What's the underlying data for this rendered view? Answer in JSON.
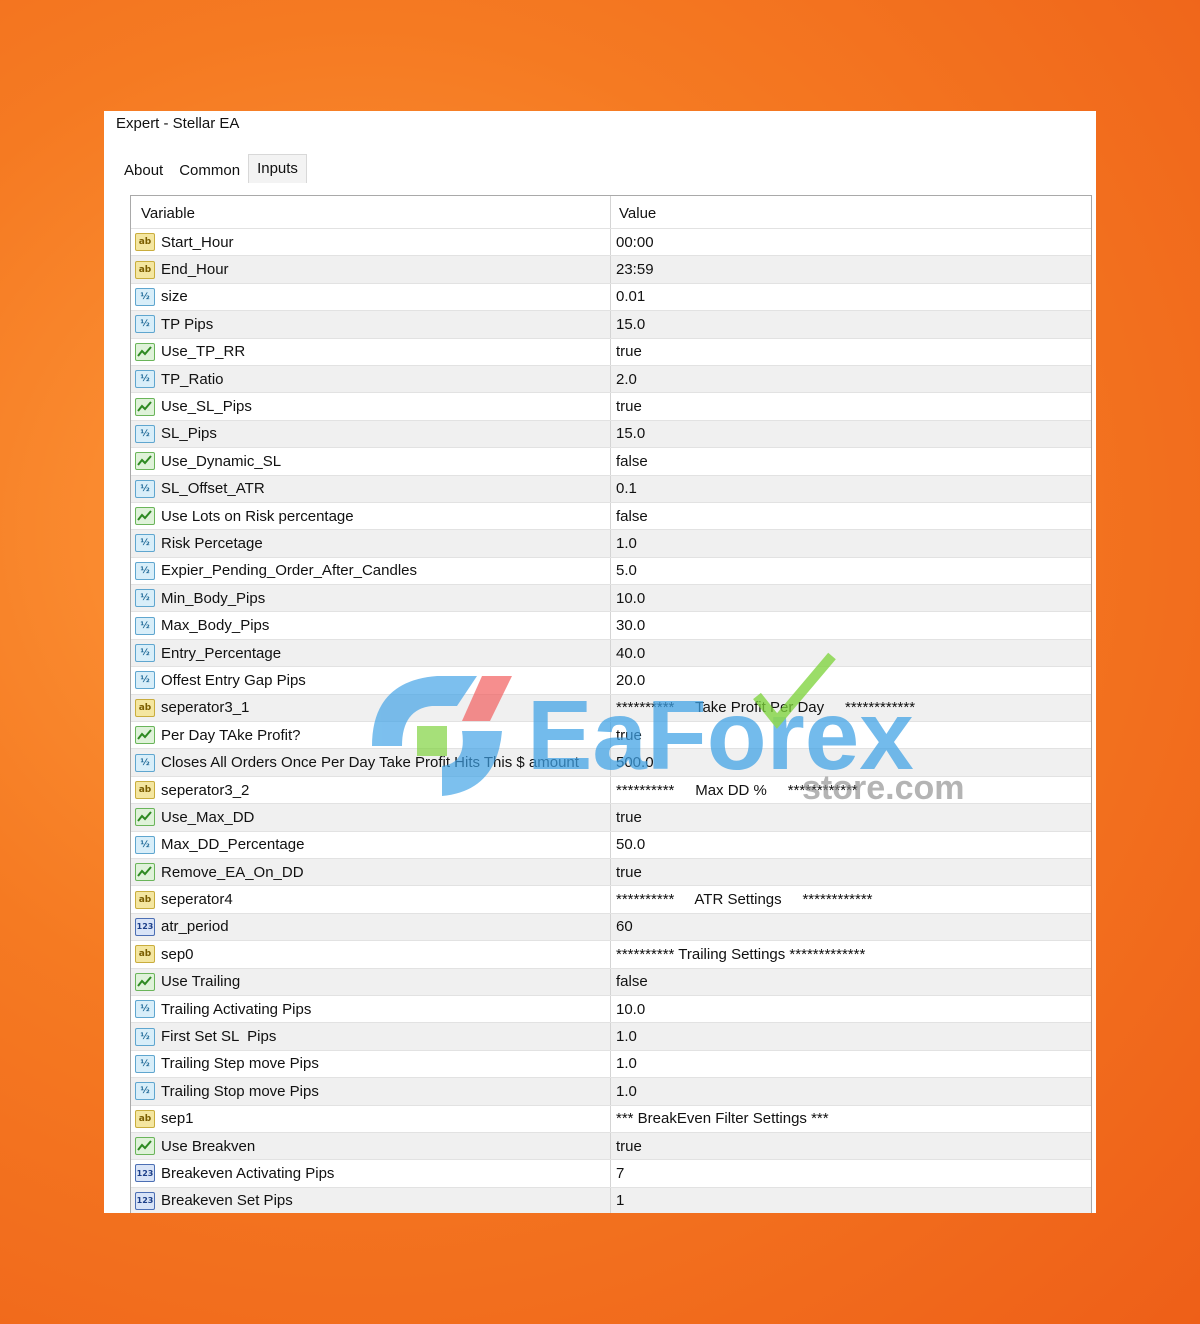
{
  "window": {
    "title": "Expert - Stellar EA"
  },
  "tabs": [
    {
      "label": "About",
      "active": false
    },
    {
      "label": "Common",
      "active": false
    },
    {
      "label": "Inputs",
      "active": true
    }
  ],
  "table": {
    "headers": {
      "variable": "Variable",
      "value": "Value"
    },
    "rows": [
      {
        "type": "string",
        "name": "Start_Hour",
        "value": "00:00"
      },
      {
        "type": "string",
        "name": "End_Hour",
        "value": "23:59"
      },
      {
        "type": "double",
        "name": "size",
        "value": "0.01"
      },
      {
        "type": "double",
        "name": "TP Pips",
        "value": "15.0"
      },
      {
        "type": "bool",
        "name": "Use_TP_RR",
        "value": "true"
      },
      {
        "type": "double",
        "name": "TP_Ratio",
        "value": "2.0"
      },
      {
        "type": "bool",
        "name": "Use_SL_Pips",
        "value": "true"
      },
      {
        "type": "double",
        "name": "SL_Pips",
        "value": "15.0"
      },
      {
        "type": "bool",
        "name": "Use_Dynamic_SL",
        "value": "false"
      },
      {
        "type": "double",
        "name": "SL_Offset_ATR",
        "value": "0.1"
      },
      {
        "type": "bool",
        "name": "Use Lots on Risk percentage",
        "value": "false"
      },
      {
        "type": "double",
        "name": "Risk Percetage",
        "value": "1.0"
      },
      {
        "type": "double",
        "name": "Expier_Pending_Order_After_Candles",
        "value": "5.0"
      },
      {
        "type": "double",
        "name": "Min_Body_Pips",
        "value": "10.0"
      },
      {
        "type": "double",
        "name": "Max_Body_Pips",
        "value": "30.0"
      },
      {
        "type": "double",
        "name": "Entry_Percentage",
        "value": "40.0"
      },
      {
        "type": "double",
        "name": "Offest Entry Gap Pips",
        "value": "20.0"
      },
      {
        "type": "string",
        "name": "seperator3_1",
        "value": "**********     Take Profit Per Day     ************"
      },
      {
        "type": "bool",
        "name": "Per Day TAke Profit?",
        "value": "true"
      },
      {
        "type": "double",
        "name": "Closes All Orders Once Per Day Take Profit Hits This $ amount",
        "value": "500.0"
      },
      {
        "type": "string",
        "name": "seperator3_2",
        "value": "**********     Max DD %     ************"
      },
      {
        "type": "bool",
        "name": "Use_Max_DD",
        "value": "true"
      },
      {
        "type": "double",
        "name": "Max_DD_Percentage",
        "value": "50.0"
      },
      {
        "type": "bool",
        "name": "Remove_EA_On_DD",
        "value": "true"
      },
      {
        "type": "string",
        "name": "seperator4",
        "value": "**********     ATR Settings     ************"
      },
      {
        "type": "int",
        "name": "atr_period",
        "value": "60"
      },
      {
        "type": "string",
        "name": "sep0",
        "value": "********** Trailing Settings *************"
      },
      {
        "type": "bool",
        "name": "Use Trailing",
        "value": "false"
      },
      {
        "type": "double",
        "name": "Trailing Activating Pips",
        "value": "10.0"
      },
      {
        "type": "double",
        "name": "First Set SL  Pips",
        "value": "1.0"
      },
      {
        "type": "double",
        "name": "Trailing Step move Pips",
        "value": "1.0"
      },
      {
        "type": "double",
        "name": "Trailing Stop move Pips",
        "value": "1.0"
      },
      {
        "type": "string",
        "name": "sep1",
        "value": "*** BreakEven Filter Settings ***"
      },
      {
        "type": "bool",
        "name": "Use Breakven",
        "value": "true"
      },
      {
        "type": "int",
        "name": "Breakeven Activating Pips",
        "value": "7"
      },
      {
        "type": "int",
        "name": "Breakeven Set Pips",
        "value": "1"
      }
    ]
  },
  "icons": {
    "string": "ab",
    "double": "½",
    "int": "123",
    "bool": "check-icon"
  },
  "watermark": {
    "brand": "EaForex",
    "sub": "store.com"
  },
  "colors": {
    "watermark_blue": "#3fa2e6",
    "watermark_green": "#7dd33b",
    "watermark_red": "#f25a5a"
  }
}
